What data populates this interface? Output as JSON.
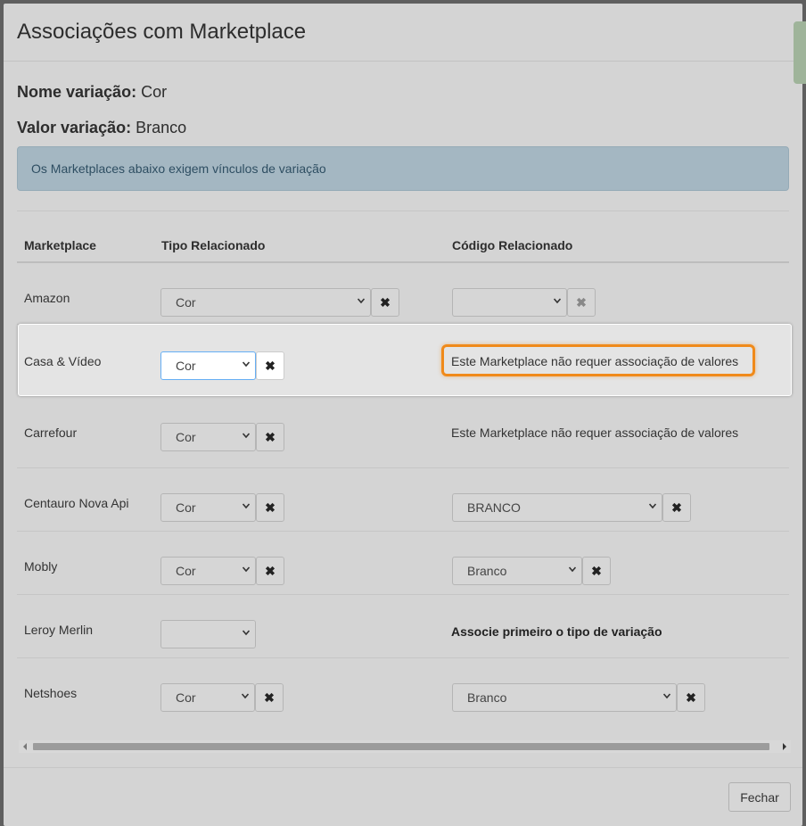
{
  "modal": {
    "title": "Associações com Marketplace",
    "variation_name_label": "Nome variação:",
    "variation_name_value": "Cor",
    "variation_value_label": "Valor variação:",
    "variation_value_value": "Branco",
    "alert_text": "Os Marketplaces abaixo exigem vínculos de variação"
  },
  "table": {
    "headers": [
      "Marketplace",
      "Tipo Relacionado",
      "Código Relacionado"
    ],
    "rows": [
      {
        "marketplace": "Amazon",
        "tipo": "Cor",
        "codigo": "",
        "codigo_msg": ""
      },
      {
        "marketplace": "Casa & Vídeo",
        "tipo": "Cor",
        "codigo": "",
        "codigo_msg": "Este Marketplace não requer associação de valores"
      },
      {
        "marketplace": "Carrefour",
        "tipo": "Cor",
        "codigo": "",
        "codigo_msg": "Este Marketplace não requer associação de valores"
      },
      {
        "marketplace": "Centauro Nova Api",
        "tipo": "Cor",
        "codigo": "BRANCO",
        "codigo_msg": ""
      },
      {
        "marketplace": "Mobly",
        "tipo": "Cor",
        "codigo": "Branco",
        "codigo_msg": ""
      },
      {
        "marketplace": "Leroy Merlin",
        "tipo": "",
        "codigo": "",
        "codigo_msg": "Associe primeiro o tipo de variação"
      },
      {
        "marketplace": "Netshoes",
        "tipo": "Cor",
        "codigo": "Branco",
        "codigo_msg": ""
      }
    ]
  },
  "icons": {
    "clear": "✖"
  },
  "footer": {
    "close_label": "Fechar"
  },
  "colors": {
    "highlight_border": "#f08a1a",
    "alert_bg": "#a4b7c2",
    "focus_border": "#66aff5"
  }
}
